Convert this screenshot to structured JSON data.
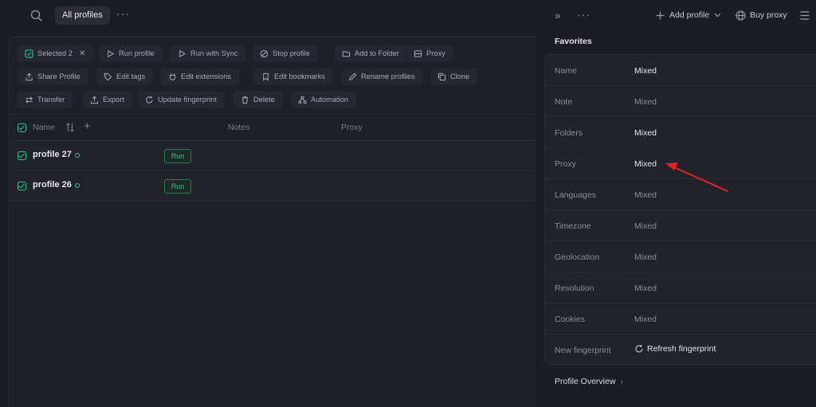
{
  "topbar": {
    "search_icon": "search-icon",
    "tab_label": "All profiles",
    "more_icon": "more-horizontal-icon",
    "more_text": "···"
  },
  "actions": {
    "selected_label": "Selected 2",
    "close_text": "✕",
    "run_profile": "Run profile",
    "run_with_sync": "Run with Sync",
    "stop_profile": "Stop profile",
    "add_to_folder": "Add to Folder",
    "proxy": "Proxy",
    "share_profile": "Share Profile",
    "edit_tags": "Edit tags",
    "edit_extensions": "Edit extensions",
    "edit_bookmarks": "Edit bookmarks",
    "rename_profiles": "Rename profiles",
    "clone": "Clone",
    "transfer": "Transfer",
    "export": "Export",
    "update_fingerprint": "Update fingerprint",
    "delete": "Delete",
    "automation": "Automation"
  },
  "table": {
    "columns": {
      "name": "Name",
      "notes": "Notes",
      "proxy": "Proxy"
    },
    "plus_text": "+",
    "rows": [
      {
        "name": "profile 27",
        "run_label": "Run"
      },
      {
        "name": "profile 26",
        "run_label": "Run"
      }
    ]
  },
  "right": {
    "collapse_text": "»",
    "more_text": "···",
    "add_profile": "Add profile",
    "buy_proxy": "Buy proxy",
    "favorites_title": "Favorites",
    "fields": [
      {
        "label": "Name",
        "value": "Mixed"
      },
      {
        "label": "Note",
        "value": "Mixed"
      },
      {
        "label": "Folders",
        "value": "Mixed"
      },
      {
        "label": "Proxy",
        "value": "Mixed"
      },
      {
        "label": "Languages",
        "value": "Mixed"
      },
      {
        "label": "Timezone",
        "value": "Mixed"
      },
      {
        "label": "Geolocation",
        "value": "Mixed"
      },
      {
        "label": "Resolution",
        "value": "Mixed"
      },
      {
        "label": "Cookies",
        "value": "Mixed"
      }
    ],
    "new_fingerprint_label": "New fingerprint",
    "refresh_fingerprint": "Refresh fingerprint",
    "profile_overview": "Profile Overview",
    "overview_chev": "›"
  },
  "colors": {
    "accent": "#33c28a",
    "annotation_arrow": "#e02424",
    "background": "#1c1c24"
  }
}
